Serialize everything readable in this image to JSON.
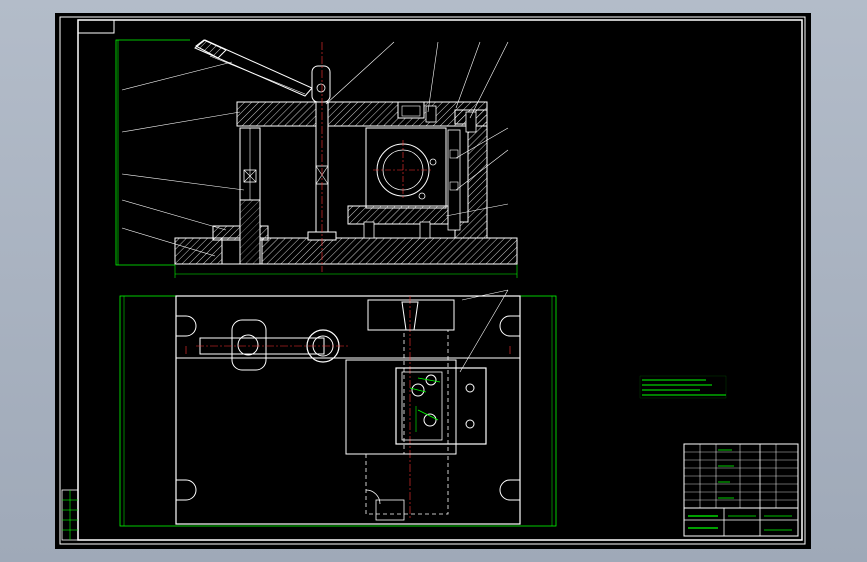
{
  "drawing": {
    "background": "#000000",
    "border_color": "#ffffff",
    "dimension_color": "#00ff00",
    "center_line_color": "#ff3333",
    "hidden_line_color": "#ffffff",
    "hatch_color": "#ffffff"
  },
  "tech_notes": {
    "lines": [
      "",
      "",
      "",
      ""
    ]
  },
  "title_block": {
    "rows": [
      "",
      "",
      "",
      "",
      "",
      "",
      "",
      "",
      "",
      ""
    ]
  }
}
